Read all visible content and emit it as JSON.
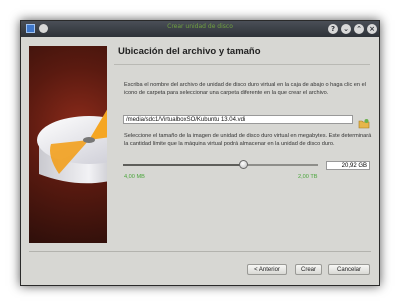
{
  "window": {
    "title": "Crear unidad de disco"
  },
  "titlebar": {
    "help_glyph": "?",
    "minimize_glyph": "⌄",
    "maximize_glyph": "⌃",
    "close_glyph": "×"
  },
  "page": {
    "heading": "Ubicación del archivo y tamaño",
    "instructions": "Escriba el nombre del archivo de unidad de disco duro virtual en la caja de abajo o haga clic en el icono de carpeta para seleccionar una carpeta diferente en la que crear el archivo.",
    "file_path": "/media/sdc1/VirtualboxSO/Kubuntu 13.04.vdi",
    "size_instructions": "Seleccione el tamaño de la imagen de unidad de disco duro virtual en megabytes. Este determinará la cantidad límite que la máquina virtual podrá almacenar en la unidad de disco duro.",
    "size_value": "20,92 GB",
    "slider_fraction": 0.62,
    "min_label": "4,00 MB",
    "max_label": "2,00 TB"
  },
  "buttons": {
    "back": "< Anterior",
    "create": "Crear",
    "cancel": "Cancelar"
  },
  "icons": {
    "app": "virtualbox-icon",
    "folder": "folder-icon"
  },
  "colors": {
    "range_labels": "#49a53a",
    "title_text": "#6fa13f"
  }
}
